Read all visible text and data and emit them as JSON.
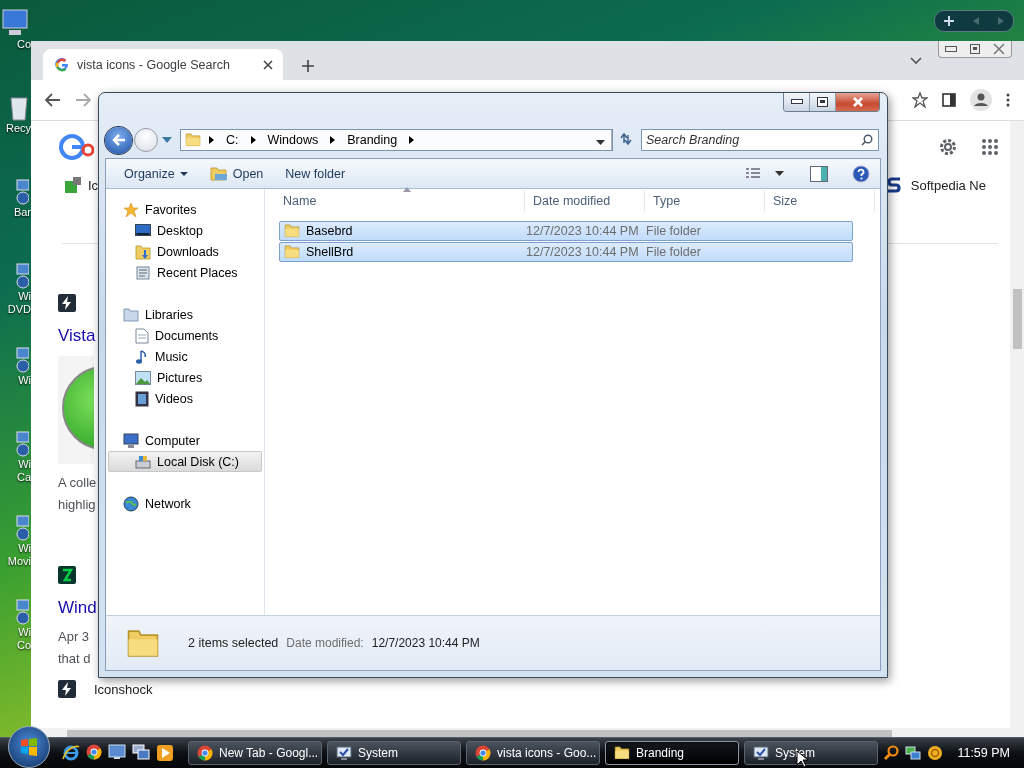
{
  "desktop_icons": [
    {
      "label": "Co",
      "kind": "computer"
    },
    {
      "label": "Recy",
      "kind": "bin"
    },
    {
      "label": "Bar",
      "kind": "app"
    },
    {
      "label": "Wi DVD",
      "kind": "app"
    },
    {
      "label": "Wi",
      "kind": "app"
    },
    {
      "label": "Wi Ca",
      "kind": "app"
    },
    {
      "label": "Wi Movi",
      "kind": "app"
    },
    {
      "label": "Wi Co",
      "kind": "app"
    }
  ],
  "browser": {
    "tab": {
      "title": "vista icons - Google Search"
    },
    "page": {
      "top_left": "Ic",
      "top_right": "Softpedia Ne",
      "results": [
        {
          "kind": "bolt",
          "title": "Vista",
          "thumbnail": true,
          "snippet": [
            "A colle",
            "highlig"
          ]
        },
        {
          "kind": "leaf",
          "title": "Wind",
          "thumbnail": false,
          "snippet": [
            "Apr 3",
            "that d"
          ]
        },
        {
          "kind": "bolt",
          "source": "Iconshock"
        }
      ]
    }
  },
  "explorer": {
    "breadcrumb": [
      "C:",
      "Windows",
      "Branding"
    ],
    "search": {
      "placeholder": "Search Branding"
    },
    "commands": [
      {
        "label": "Organize",
        "kind": "menu"
      },
      {
        "label": "Open",
        "kind": "open"
      },
      {
        "label": "New folder",
        "kind": "plain"
      }
    ],
    "nav_pane": [
      {
        "label": "Favorites",
        "kind": "star",
        "selected": false,
        "children": [
          {
            "label": "Desktop",
            "kind": "desktop",
            "selected": false
          },
          {
            "label": "Downloads",
            "kind": "downloads",
            "selected": false
          },
          {
            "label": "Recent Places",
            "kind": "recent",
            "selected": false
          }
        ]
      },
      {
        "label": "Libraries",
        "kind": "library",
        "selected": false,
        "children": [
          {
            "label": "Documents",
            "kind": "document",
            "selected": false
          },
          {
            "label": "Music",
            "kind": "music",
            "selected": false
          },
          {
            "label": "Pictures",
            "kind": "picture",
            "selected": false
          },
          {
            "label": "Videos",
            "kind": "video",
            "selected": false
          }
        ]
      },
      {
        "label": "Computer",
        "kind": "computer",
        "selected": false,
        "children": [
          {
            "label": "Local Disk (C:)",
            "kind": "drive",
            "selected": true
          }
        ]
      },
      {
        "label": "Network",
        "kind": "network",
        "selected": false
      }
    ],
    "columns": [
      "Name",
      "Date modified",
      "Type",
      "Size"
    ],
    "files": [
      {
        "name": "Basebrd",
        "date": "12/7/2023 10:44 PM",
        "type": "File folder",
        "selected": true
      },
      {
        "name": "ShellBrd",
        "date": "12/7/2023 10:44 PM",
        "type": "File folder",
        "selected": true
      }
    ],
    "details": {
      "summary": "2 items selected",
      "label": "Date modified:",
      "value": "12/7/2023 10:44 PM"
    }
  },
  "taskbar": {
    "tasks": [
      {
        "label": "New Tab - Googl...",
        "kind": "chrome",
        "selected": false
      },
      {
        "label": "System",
        "kind": "system",
        "selected": false
      },
      {
        "label": "vista icons - Goo...",
        "kind": "chrome",
        "selected": false
      },
      {
        "label": "Branding",
        "kind": "folder",
        "selected": true
      },
      {
        "label": "System",
        "kind": "system",
        "selected": false
      }
    ],
    "clock": "11:59 PM"
  }
}
